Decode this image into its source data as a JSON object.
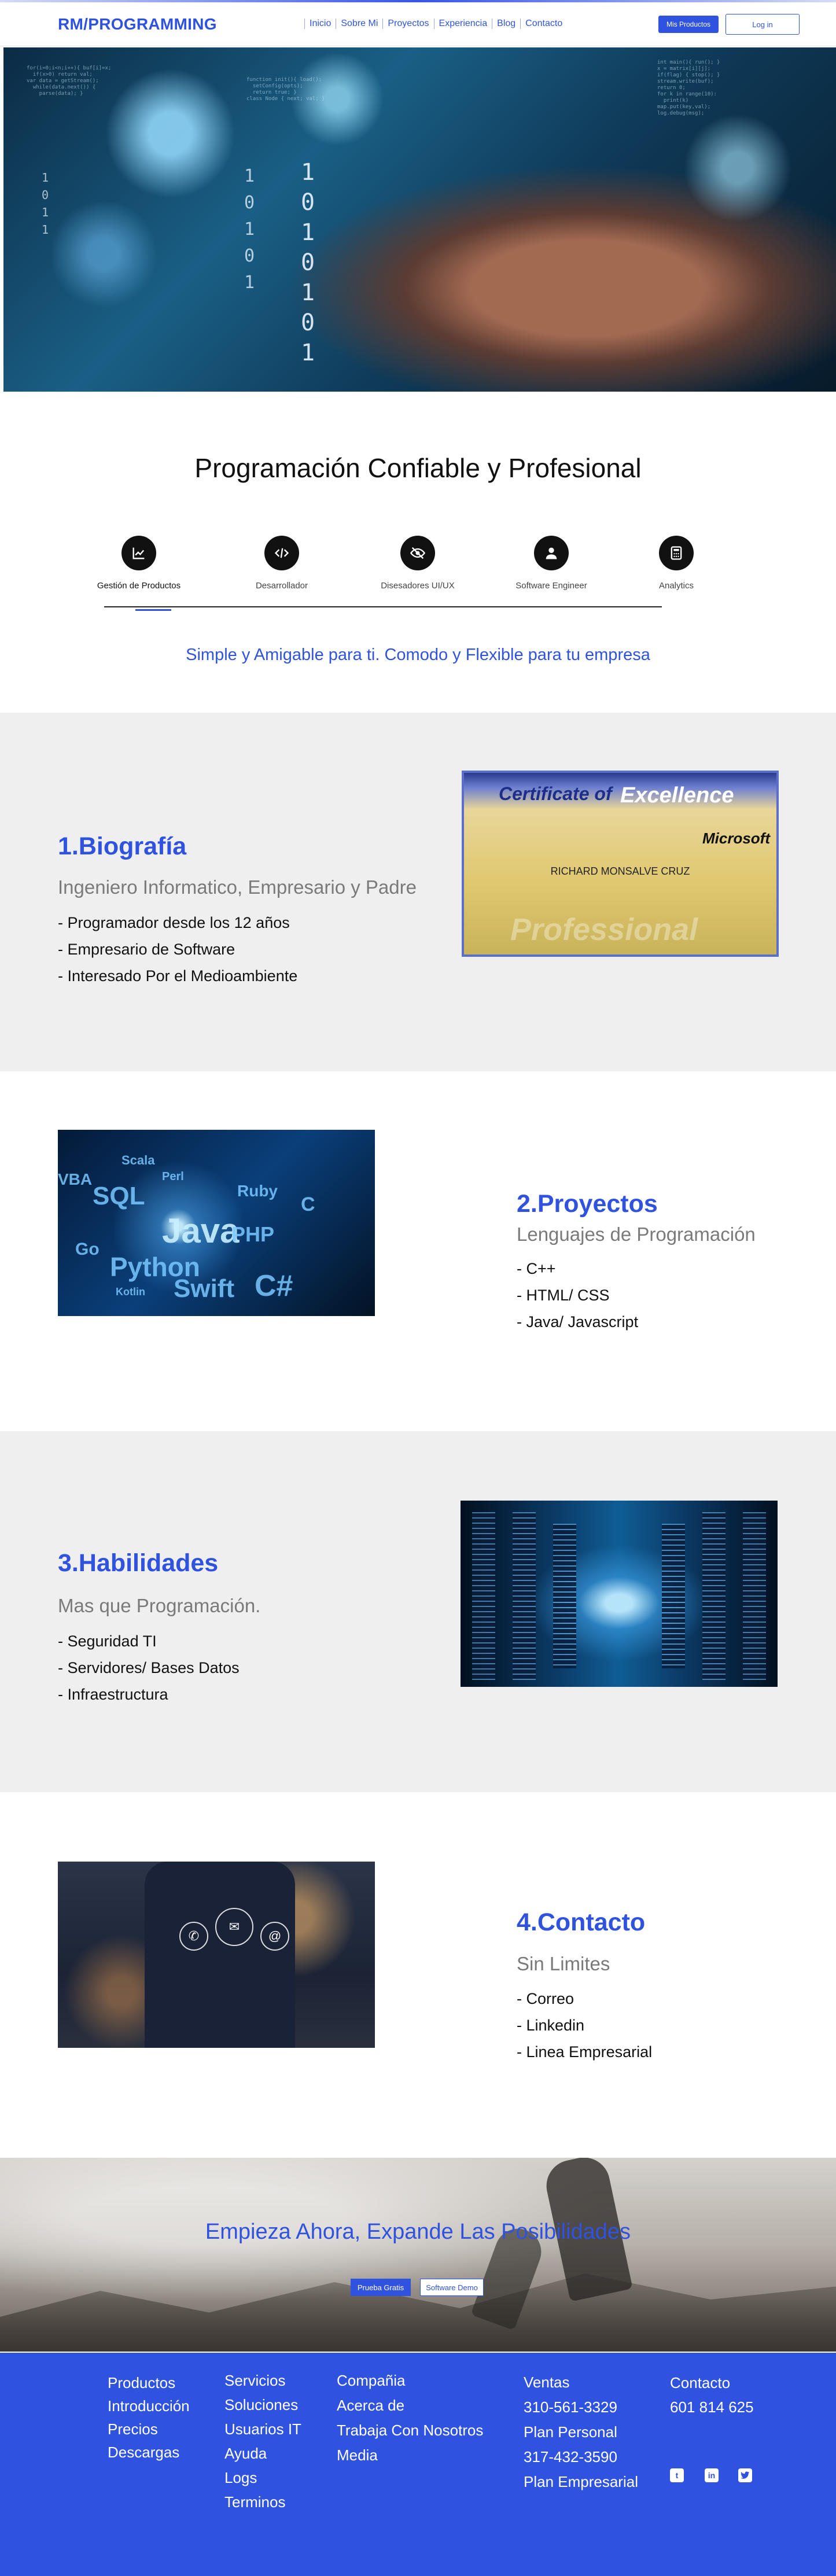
{
  "header": {
    "brand": "RM/PROGRAMMING",
    "nav": [
      "Inicio",
      "Sobre Mi",
      "Proyectos",
      "Experiencia",
      "Blog",
      "Contacto"
    ],
    "products_button": "Mis Productos",
    "login_button": "Log in"
  },
  "intro": {
    "title": "Programación Confiable y Profesional",
    "tabs": [
      {
        "label": "Gestión de Productos",
        "icon": "chart-icon"
      },
      {
        "label": "Desarrollador",
        "icon": "code-icon"
      },
      {
        "label": "Disesadores UI/UX",
        "icon": "eye-icon"
      },
      {
        "label": "Software Engineer",
        "icon": "user-icon"
      },
      {
        "label": "Analytics",
        "icon": "calculator-icon"
      }
    ],
    "subtitle": "Simple y Amigable para ti. Comodo y Flexible  para tu empresa"
  },
  "sections": [
    {
      "title": "1.Biografía",
      "subtitle": "Ingeniero Informatico,  Empresario y Padre",
      "items": [
        "- Programador desde los 12 años",
        "- Empresario de Software",
        "- Interesado Por el Medioambiente"
      ],
      "image": {
        "heading_a": "Certificate of",
        "heading_b": "Excellence",
        "brand": "Microsoft",
        "name": "RICHARD MONSALVE CRUZ",
        "watermark": "Professional"
      }
    },
    {
      "title": "2.Proyectos",
      "subtitle": "Lenguajes de Programación",
      "items": [
        "- C++",
        "- HTML/ CSS",
        "- Java/ Javascript"
      ],
      "image": {
        "words": [
          "SQL",
          "Java",
          "Python",
          "Swift",
          "C#",
          "PHP",
          "Ruby",
          "Scala",
          "Perl",
          "VBA",
          "Go",
          "Kotlin",
          "C"
        ]
      }
    },
    {
      "title": "3.Habilidades",
      "subtitle": "Mas que Programación.",
      "items": [
        "- Seguridad TI",
        "- Servidores/ Bases Datos",
        "- Infraestructura"
      ]
    },
    {
      "title": "4.Contacto",
      "subtitle": "Sin Limites",
      "items": [
        "- Correo",
        "- Linkedin",
        "- Linea Empresarial"
      ]
    }
  ],
  "cta": {
    "title": "Empieza Ahora, Expande Las Posibilidades",
    "free_button": "Prueba Gratis",
    "demo_button": "Software Demo"
  },
  "footer": {
    "col1": [
      "Productos",
      "Introducción",
      "Precios",
      "Descargas"
    ],
    "col2": [
      "Servicios",
      "Soluciones",
      "Usuarios IT",
      "Ayuda",
      "Logs",
      "Terminos"
    ],
    "col3": [
      "Compañia",
      "Acerca de",
      "Trabaja Con Nosotros",
      "Media"
    ],
    "col4": [
      "Ventas",
      "310-561-3329",
      "Plan Personal",
      "317-432-3590",
      "Plan Empresarial"
    ],
    "col5": [
      "Contacto",
      "601 814 625"
    ],
    "social": [
      "tumblr-icon",
      "linkedin-icon",
      "twitter-icon"
    ]
  },
  "colors": {
    "accent": "#2f53df",
    "section_gray": "#efefef",
    "footer": "#2f53df"
  }
}
